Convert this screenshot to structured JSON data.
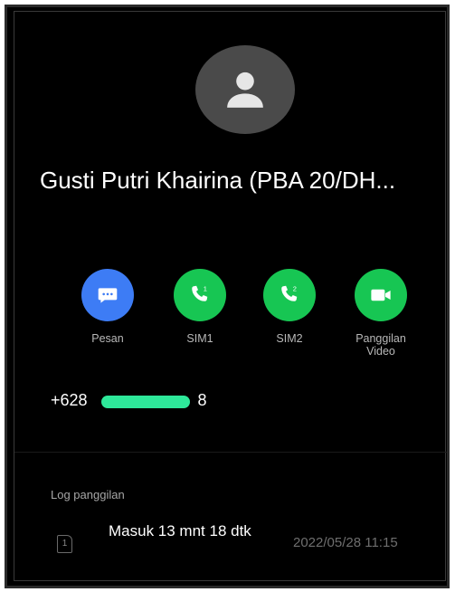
{
  "contact": {
    "name": "Gusti Putri Khairina (PBA 20/DH...",
    "phone_visible_prefix": "+628",
    "phone_visible_suffix": "8"
  },
  "actions": [
    {
      "id": "message",
      "label": "Pesan",
      "icon": "message-icon",
      "color": "#3d7cf5"
    },
    {
      "id": "sim1",
      "label": "SIM1",
      "icon": "phone-sim1-icon",
      "color": "#17c653"
    },
    {
      "id": "sim2",
      "label": "SIM2",
      "icon": "phone-sim2-icon",
      "color": "#17c653"
    },
    {
      "id": "video",
      "label": "Panggilan\nVideo",
      "icon": "video-camera-icon",
      "color": "#17c653"
    }
  ],
  "call_log": {
    "title": "Log panggilan",
    "entries": [
      {
        "sim": "1",
        "type": "Masuk 13 mnt 18 dtk",
        "datetime": "2022/05/28 11:15"
      }
    ]
  },
  "colors": {
    "background": "#000000",
    "avatar": "#4a4a4a",
    "redaction_marker": "#2ee89a"
  }
}
